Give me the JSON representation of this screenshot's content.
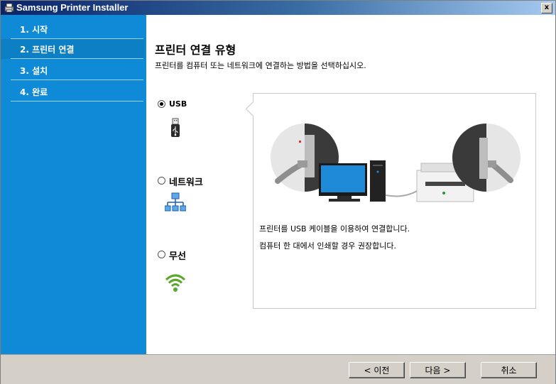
{
  "window": {
    "title": "Samsung Printer Installer",
    "close_label": "x"
  },
  "sidebar": {
    "items": [
      {
        "label": "1. 시작",
        "active": false
      },
      {
        "label": "2. 프린터 연결",
        "active": true
      },
      {
        "label": "3. 설치",
        "active": false
      },
      {
        "label": "4. 완료",
        "active": false
      }
    ]
  },
  "main": {
    "title": "프린터 연결 유형",
    "description": "프린터를 컴퓨터 또는 네트워크에 연결하는 방법을 선택하십시오.",
    "options": [
      {
        "label": "USB",
        "selected": true,
        "icon": "usb-plug-icon"
      },
      {
        "label": "네트워크",
        "selected": false,
        "icon": "network-icon"
      },
      {
        "label": "무선",
        "selected": false,
        "icon": "wifi-icon"
      }
    ],
    "panel": {
      "line1": "프린터를 USB 케이블을 이용하여 연결합니다.",
      "line2": "컴퓨터 한 대에서 인쇄할 경우 권장합니다."
    }
  },
  "footer": {
    "back_label": "< 이전",
    "next_label": "다음 >",
    "cancel_label": "취소"
  },
  "colors": {
    "sidebar": "#0f8ad7",
    "titlebar": "#0a246a",
    "wifi": "#5aa82a"
  }
}
